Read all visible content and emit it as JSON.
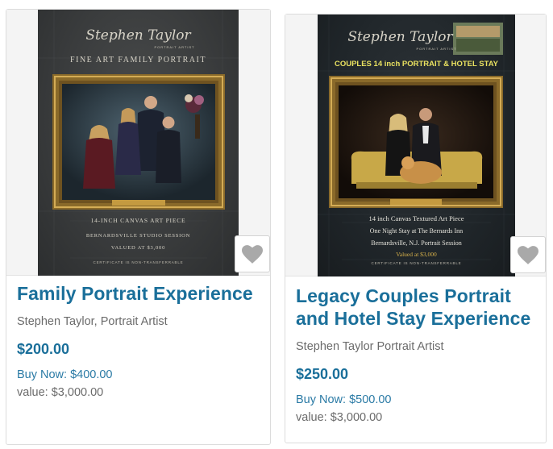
{
  "products": [
    {
      "title": "Family Portrait Experience",
      "artist": "Stephen Taylor, Portrait Artist",
      "price": "$200.00",
      "buy_now": "Buy Now: $400.00",
      "value": "value: $3,000.00",
      "poster": {
        "signature": "Stephen Taylor",
        "signature_sub": "PORTRAIT ARTIST",
        "headline": "FINE ART FAMILY PORTRAIT",
        "lines": [
          "14-INCH CANVAS ART PIECE",
          "BERNARDSVILLE STUDIO SESSION",
          "VALUED AT $3,000"
        ],
        "fine_print": "CERTIFICATE IS NON-TRANSFERRABLE"
      },
      "favorite_icon": "heart-icon"
    },
    {
      "title": "Legacy Couples Portrait and Hotel Stay Experience",
      "artist": "Stephen Taylor Portrait Artist",
      "price": "$250.00",
      "buy_now": "Buy Now: $500.00",
      "value": "value: $3,000.00",
      "poster": {
        "signature": "Stephen Taylor",
        "signature_sub": "PORTRAIT ARTIST",
        "headline": "COUPLES 14 inch PORTRAIT & HOTEL STAY",
        "lines": [
          "14 inch Canvas Textured Art Piece",
          "One Night Stay at The Bernards Inn",
          "Bernardsville, N.J. Portrait Session"
        ],
        "value_line": "Valued at $3,000",
        "fine_print": "CERTIFICATE IS NON-TRANSFERRABLE"
      },
      "favorite_icon": "heart-icon"
    }
  ],
  "colors": {
    "title": "#1a6f9a",
    "price": "#1a6f9a",
    "muted": "#6b6b6b",
    "heart": "#a9a9a9",
    "frame_gold": "#b08a3a"
  }
}
